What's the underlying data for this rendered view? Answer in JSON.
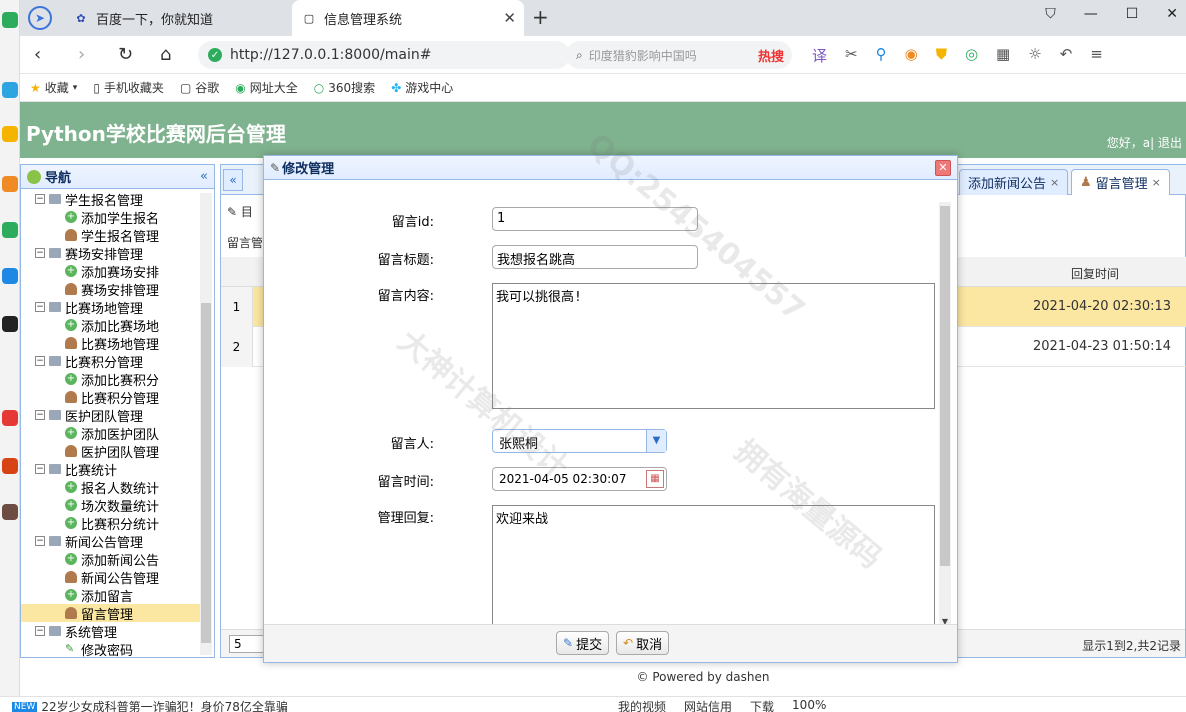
{
  "browser": {
    "tabs": [
      {
        "label": "百度一下，你就知道"
      },
      {
        "label": "信息管理系统"
      }
    ],
    "url": "http://127.0.0.1:8000/main#",
    "search_placeholder": "印度猎豹影响中国吗",
    "search_hot": "热搜",
    "bookmarks": [
      "收藏",
      "手机收藏夹",
      "谷歌",
      "网址大全",
      "360搜索",
      "游戏中心"
    ]
  },
  "header": {
    "title": "Python学校比赛网后台管理",
    "greeting": "您好，a| 退出"
  },
  "nav": {
    "title": "导航",
    "groups": [
      {
        "label": "学生报名管理",
        "items": [
          {
            "label": "添加学生报名",
            "icon": "add"
          },
          {
            "label": "学生报名管理",
            "icon": "person"
          }
        ]
      },
      {
        "label": "赛场安排管理",
        "items": [
          {
            "label": "添加赛场安排",
            "icon": "add"
          },
          {
            "label": "赛场安排管理",
            "icon": "person"
          }
        ]
      },
      {
        "label": "比赛场地管理",
        "items": [
          {
            "label": "添加比赛场地",
            "icon": "add"
          },
          {
            "label": "比赛场地管理",
            "icon": "person"
          }
        ]
      },
      {
        "label": "比赛积分管理",
        "items": [
          {
            "label": "添加比赛积分",
            "icon": "add"
          },
          {
            "label": "比赛积分管理",
            "icon": "person"
          }
        ]
      },
      {
        "label": "医护团队管理",
        "items": [
          {
            "label": "添加医护团队",
            "icon": "add"
          },
          {
            "label": "医护团队管理",
            "icon": "person"
          }
        ]
      },
      {
        "label": "比赛统计",
        "items": [
          {
            "label": "报名人数统计",
            "icon": "add"
          },
          {
            "label": "场次数量统计",
            "icon": "add"
          },
          {
            "label": "比赛积分统计",
            "icon": "add"
          }
        ]
      },
      {
        "label": "新闻公告管理",
        "items": [
          {
            "label": "添加新闻公告",
            "icon": "add"
          },
          {
            "label": "新闻公告管理",
            "icon": "person"
          },
          {
            "label": "添加留言",
            "icon": "add"
          },
          {
            "label": "留言管理",
            "icon": "person",
            "selected": true
          }
        ]
      },
      {
        "label": "系统管理",
        "items": [
          {
            "label": "修改密码",
            "icon": "pen"
          }
        ]
      }
    ]
  },
  "main": {
    "tabs": [
      "添加新闻公告",
      "留言管理"
    ],
    "toolbar_visible": "目",
    "toolbar_label": "留言管",
    "column_header": "回复时间",
    "rows": [
      {
        "num": "1",
        "reply_time": "2021-04-20 02:30:13"
      },
      {
        "num": "2",
        "reply_time": "2021-04-23 01:50:14"
      }
    ],
    "page_size": "5",
    "pager_info": "显示1到2,共2记录"
  },
  "footer": "© Powered by dashen",
  "dialog": {
    "title": "修改管理",
    "fields": {
      "id_label": "留言id:",
      "id_value": "1",
      "title_label": "留言标题:",
      "title_value": "我想报名跳高",
      "content_label": "留言内容:",
      "content_value": "我可以挑很高!",
      "person_label": "留言人:",
      "person_value": "张熙桐",
      "time_label": "留言时间:",
      "time_value": "2021-04-05 02:30:07",
      "reply_label": "管理回复:",
      "reply_value": "欢迎来战"
    },
    "submit": "提交",
    "cancel": "取消"
  },
  "status": {
    "news": "22岁少女成科普第一诈骗犯！身价78亿全靠骗",
    "right": [
      "我的视频",
      "网站信用",
      "下载",
      "100%"
    ]
  },
  "watermark": [
    "QQ:2545404557",
    "大神计算机设计",
    "拥有海量源码"
  ]
}
